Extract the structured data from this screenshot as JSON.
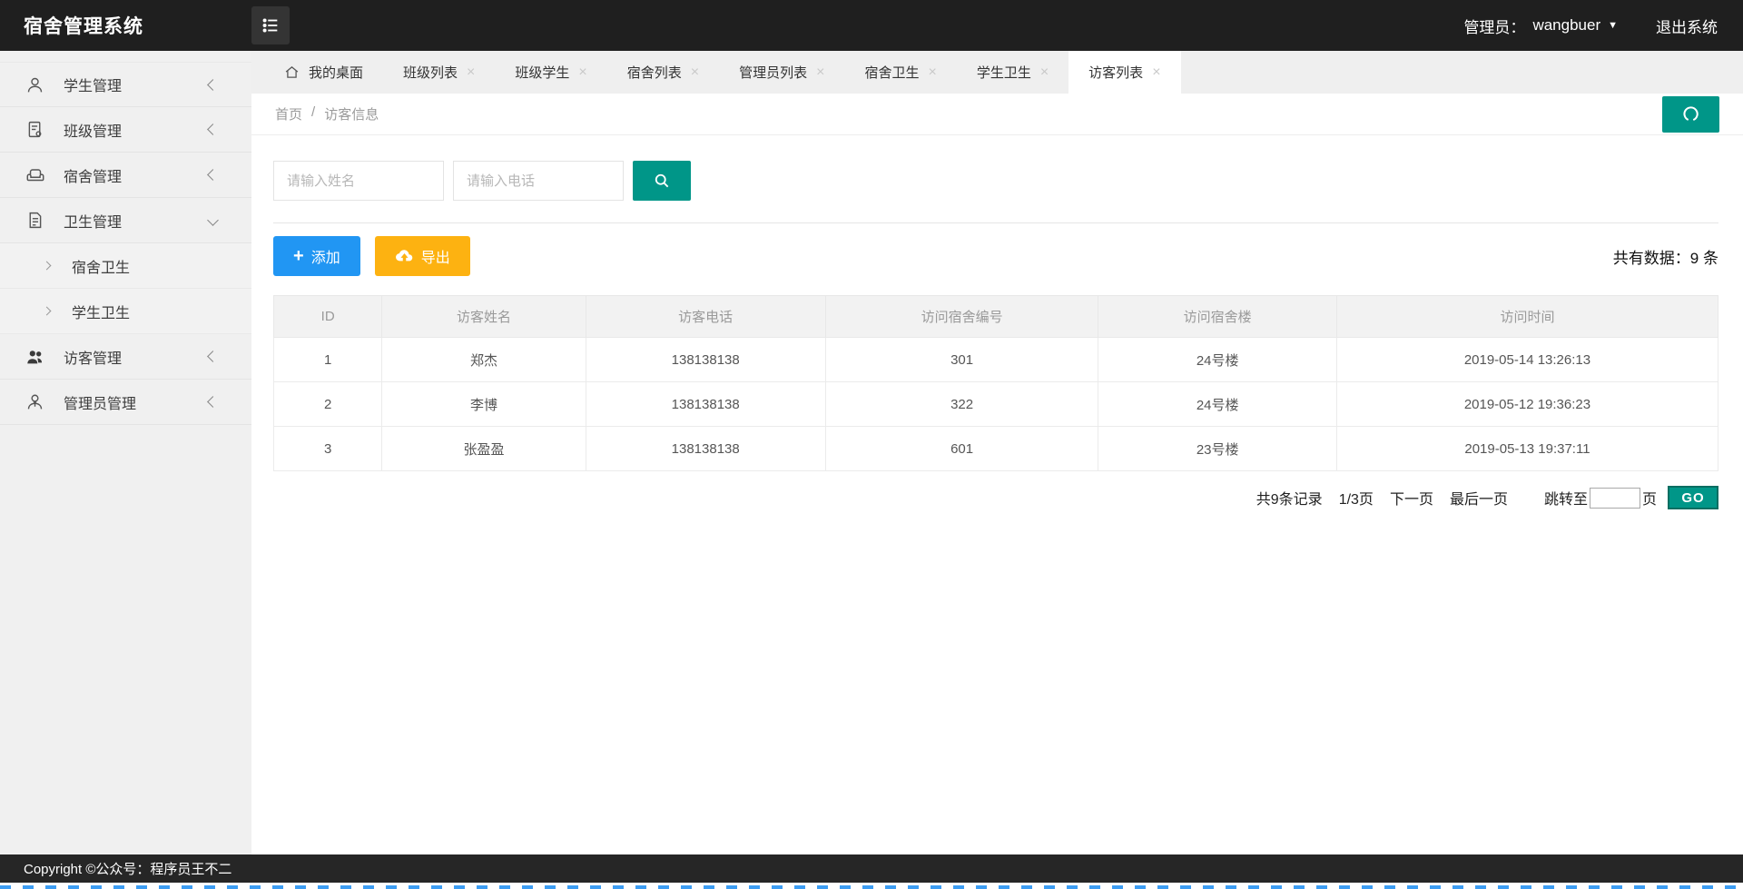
{
  "app": {
    "title": "宿舍管理系统",
    "admin_label": "管理员：",
    "admin_name": "wangbuer",
    "logout_label": "退出系统"
  },
  "sidebar": {
    "items": [
      {
        "label": "学生管理",
        "icon": "student-icon",
        "state": "collapsed"
      },
      {
        "label": "班级管理",
        "icon": "class-icon",
        "state": "collapsed"
      },
      {
        "label": "宿舍管理",
        "icon": "dorm-icon",
        "state": "collapsed"
      },
      {
        "label": "卫生管理",
        "icon": "hygiene-icon",
        "state": "expanded",
        "children": [
          {
            "label": "宿舍卫生"
          },
          {
            "label": "学生卫生"
          }
        ]
      },
      {
        "label": "访客管理",
        "icon": "visitor-icon",
        "state": "collapsed"
      },
      {
        "label": "管理员管理",
        "icon": "admin-icon",
        "state": "collapsed"
      }
    ]
  },
  "tabs": {
    "home": "我的桌面",
    "items": [
      "班级列表",
      "班级学生",
      "宿舍列表",
      "管理员列表",
      "宿舍卫生",
      "学生卫生",
      "访客列表"
    ],
    "active": "访客列表",
    "close_glyph": "×"
  },
  "breadcrumb": {
    "home": "首页",
    "separator": "/",
    "current": "访客信息"
  },
  "search": {
    "name_placeholder": "请输入姓名",
    "phone_placeholder": "请输入电话"
  },
  "toolbar": {
    "add_label": "添加",
    "add_plus": "+",
    "export_label": "导出",
    "total_label": "共有数据：",
    "total_count": "9",
    "total_unit": "条"
  },
  "table": {
    "headers": [
      "ID",
      "访客姓名",
      "访客电话",
      "访问宿舍编号",
      "访问宿舍楼",
      "访问时间"
    ],
    "rows": [
      {
        "id": "1",
        "name": "郑杰",
        "phone": "138138138",
        "room": "301",
        "building": "24号楼",
        "time": "2019-05-14 13:26:13"
      },
      {
        "id": "2",
        "name": "李博",
        "phone": "138138138",
        "room": "322",
        "building": "24号楼",
        "time": "2019-05-12 19:36:23"
      },
      {
        "id": "3",
        "name": "张盈盈",
        "phone": "138138138",
        "room": "601",
        "building": "23号楼",
        "time": "2019-05-13 19:37:11"
      }
    ]
  },
  "pagination": {
    "total_text": "共9条记录",
    "page_text": "1/3页",
    "next_label": "下一页",
    "last_label": "最后一页",
    "jump_label": "跳转至",
    "jump_unit": "页",
    "go_label": "GO",
    "jump_value": ""
  },
  "footer": {
    "copyright": "Copyright ©公众号：程序员王不二"
  },
  "colors": {
    "teal": "#009688",
    "blue": "#2196f3",
    "amber": "#fdb211",
    "topbar_bg": "#1f1f1f",
    "sidebar_bg": "#f0f0f0",
    "tabstrip_bg": "#efefef"
  }
}
